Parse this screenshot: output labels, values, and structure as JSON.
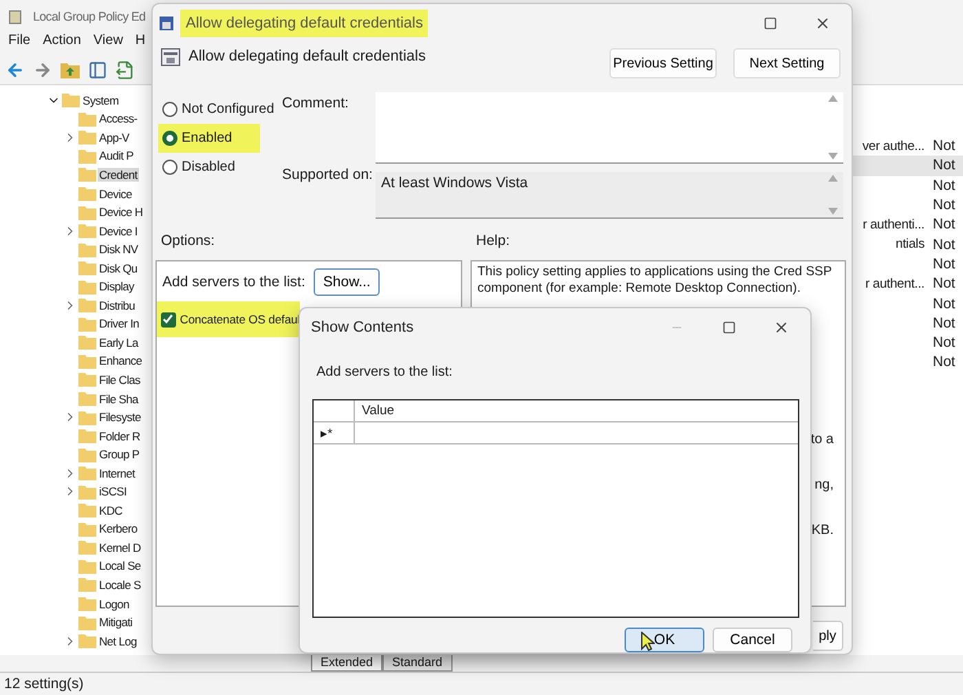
{
  "main_window": {
    "title": "Local Group Policy Ed",
    "menu": [
      "File",
      "Action",
      "View",
      "H"
    ],
    "tree": {
      "label": "System",
      "expanded": true,
      "children": [
        {
          "label": "Access-",
          "expandable": false,
          "selected": false
        },
        {
          "label": "App-V",
          "expandable": true,
          "selected": false
        },
        {
          "label": "Audit P",
          "expandable": false,
          "selected": false
        },
        {
          "label": "Credent",
          "expandable": false,
          "selected": true
        },
        {
          "label": "Device",
          "expandable": false,
          "selected": false
        },
        {
          "label": "Device H",
          "expandable": false,
          "selected": false
        },
        {
          "label": "Device I",
          "expandable": true,
          "selected": false
        },
        {
          "label": "Disk NV",
          "expandable": false,
          "selected": false
        },
        {
          "label": "Disk Qu",
          "expandable": false,
          "selected": false
        },
        {
          "label": "Display",
          "expandable": false,
          "selected": false
        },
        {
          "label": "Distribu",
          "expandable": true,
          "selected": false
        },
        {
          "label": "Driver In",
          "expandable": false,
          "selected": false
        },
        {
          "label": "Early La",
          "expandable": false,
          "selected": false
        },
        {
          "label": "Enhance",
          "expandable": false,
          "selected": false
        },
        {
          "label": "File Clas",
          "expandable": false,
          "selected": false
        },
        {
          "label": "File Sha",
          "expandable": false,
          "selected": false
        },
        {
          "label": "Filesyste",
          "expandable": true,
          "selected": false
        },
        {
          "label": "Folder R",
          "expandable": false,
          "selected": false
        },
        {
          "label": "Group P",
          "expandable": false,
          "selected": false
        },
        {
          "label": "Internet",
          "expandable": true,
          "selected": false
        },
        {
          "label": "iSCSI",
          "expandable": true,
          "selected": false
        },
        {
          "label": "KDC",
          "expandable": false,
          "selected": false
        },
        {
          "label": "Kerbero",
          "expandable": false,
          "selected": false
        },
        {
          "label": "Kernel D",
          "expandable": false,
          "selected": false
        },
        {
          "label": "Local Se",
          "expandable": false,
          "selected": false
        },
        {
          "label": "Locale S",
          "expandable": false,
          "selected": false
        },
        {
          "label": "Logon",
          "expandable": false,
          "selected": false
        },
        {
          "label": "Mitigati",
          "expandable": false,
          "selected": false
        },
        {
          "label": "Net Log",
          "expandable": true,
          "selected": false
        }
      ]
    },
    "list_rows": [
      {
        "setting": "ver authe...",
        "state": "Not",
        "selected": false
      },
      {
        "setting": "",
        "state": "Not",
        "selected": true
      },
      {
        "setting": "",
        "state": "Not",
        "selected": false
      },
      {
        "setting": "",
        "state": "Not",
        "selected": false
      },
      {
        "setting": "r authenti...",
        "state": "Not",
        "selected": false
      },
      {
        "setting": "ntials",
        "state": "Not",
        "selected": false
      },
      {
        "setting": "",
        "state": "Not",
        "selected": false
      },
      {
        "setting": "r authent...",
        "state": "Not",
        "selected": false
      },
      {
        "setting": "",
        "state": "Not",
        "selected": false
      },
      {
        "setting": "",
        "state": "Not",
        "selected": false
      },
      {
        "setting": "",
        "state": "Not",
        "selected": false
      },
      {
        "setting": "",
        "state": "Not",
        "selected": false
      }
    ],
    "tabs": [
      {
        "label": "Extended",
        "selected": true
      },
      {
        "label": "Standard",
        "selected": false
      }
    ],
    "status": "12 setting(s)"
  },
  "policy_dialog": {
    "title": "Allow delegating default credentials",
    "title_highlighted": true,
    "heading": "Allow delegating default credentials",
    "nav_buttons": [
      "Previous Setting",
      "Next Setting"
    ],
    "options": [
      {
        "label": "Not Configured",
        "selected": false,
        "highlighted": false
      },
      {
        "label": "Enabled",
        "selected": true,
        "highlighted": true
      },
      {
        "label": "Disabled",
        "selected": false,
        "highlighted": false
      }
    ],
    "comment_label": "Comment:",
    "supported_label": "Supported on:",
    "supported": "At least Windows Vista",
    "options_label": "Options:",
    "help_label": "Help:",
    "servers_label": "Add servers to the list:",
    "show_button": "Show...",
    "concatenate": {
      "label": "Concatenate OS defaul",
      "checked": true,
      "highlighted": true
    },
    "help_text": "This policy setting applies to applications using the Cred SSP component (for example: Remote Desktop Connection).",
    "help_fragments": [
      "to a",
      "ng,",
      "KB."
    ],
    "apply_button": "ply"
  },
  "show_dialog": {
    "title": "Show Contents",
    "label": "Add servers to the list:",
    "column": "Value",
    "new_row_marker": "▸*",
    "buttons": [
      {
        "label": "OK",
        "focused": true
      },
      {
        "label": "Cancel",
        "focused": false
      }
    ]
  }
}
